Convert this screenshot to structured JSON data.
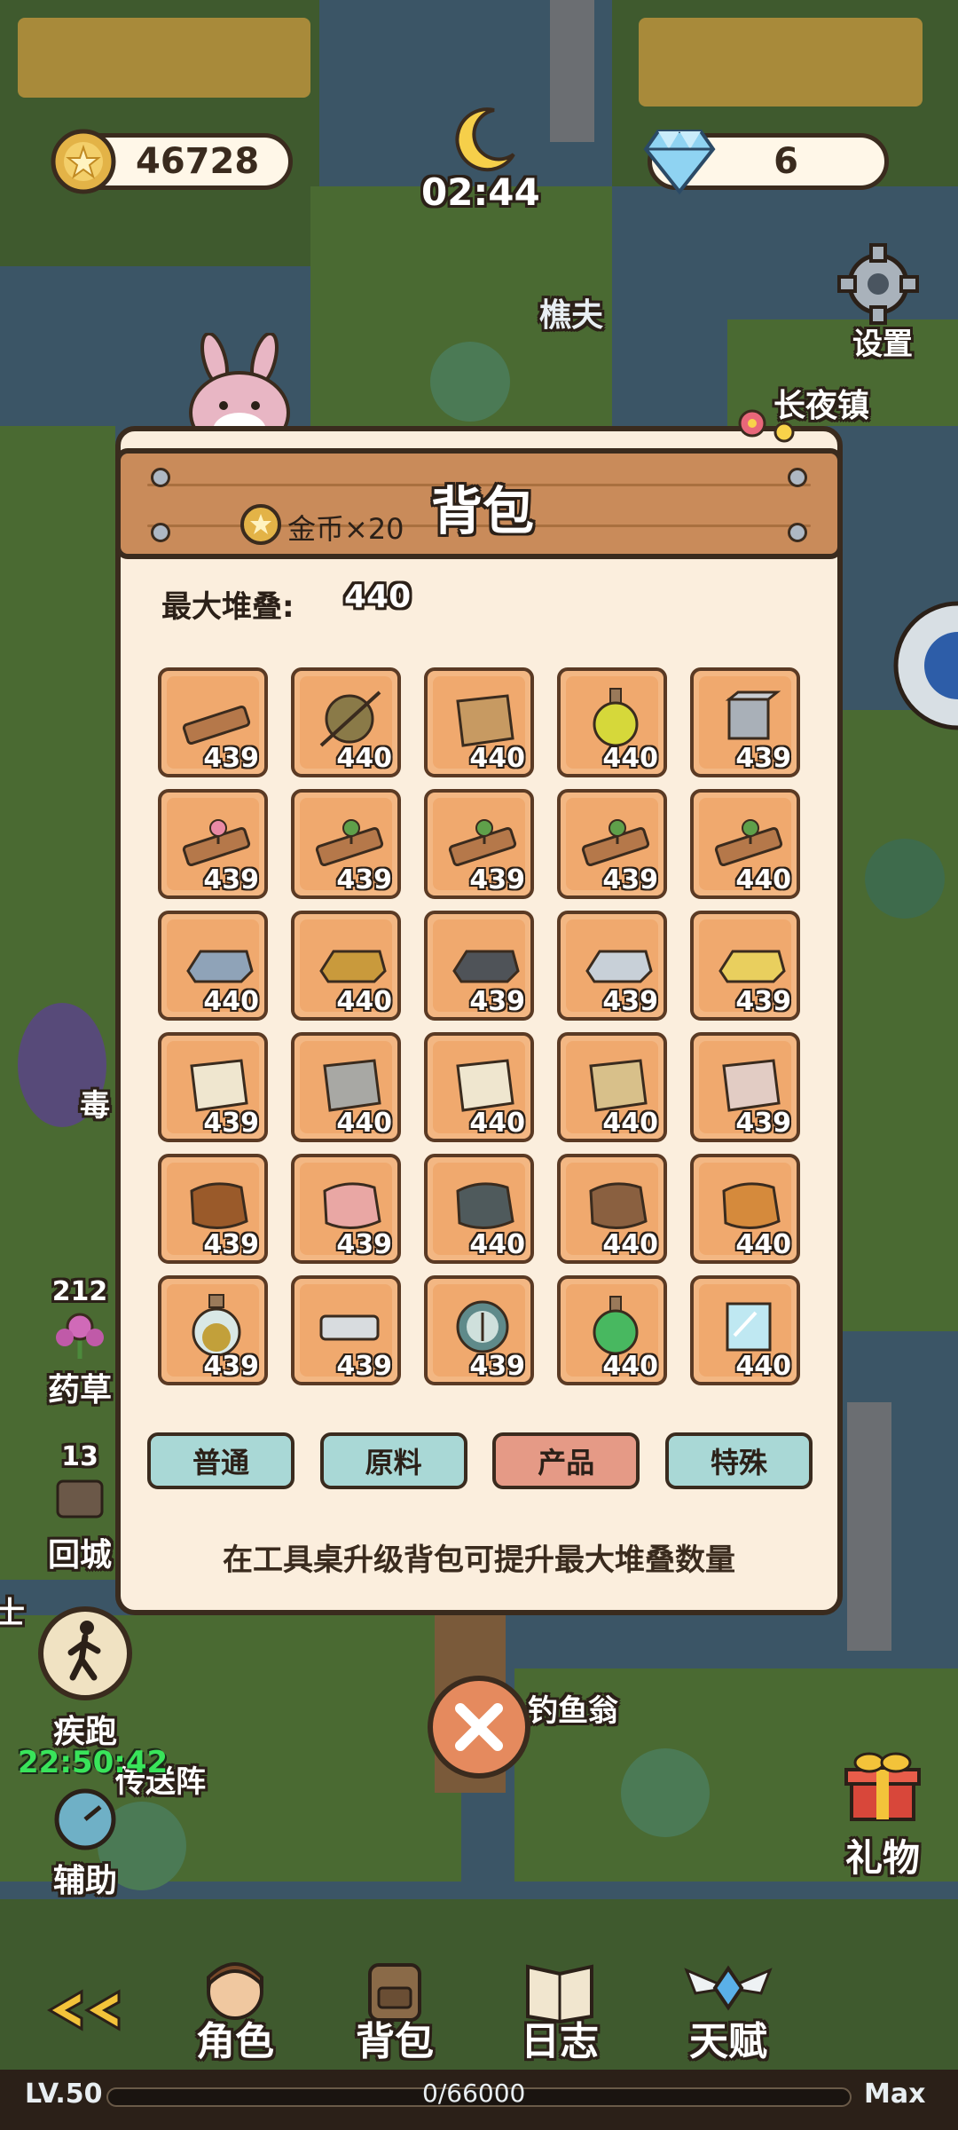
{
  "hud": {
    "coins": "46728",
    "time": "02:44",
    "gems": "6",
    "settings_label": "设置"
  },
  "map_labels": {
    "npc_woodcutter": "樵夫",
    "town": "长夜镇",
    "fisherman": "钓鱼翁",
    "poison": "毒",
    "teleport": "传送阵"
  },
  "side": {
    "herb_count": "212",
    "herb_label": "药草",
    "return_count": "13",
    "return_label": "回城",
    "run_label": "疾跑",
    "timer": "22:50:42",
    "assist_label": "辅助",
    "gift_label": "礼物",
    "left_edge_char": "士"
  },
  "inventory": {
    "title": "背包",
    "coin_reward": "金币×20",
    "max_stack_label": "最大堆叠:",
    "max_stack_value": "440",
    "items": [
      {
        "icon": "wood-plank-icon",
        "count": "439"
      },
      {
        "icon": "yarn-ball-icon",
        "count": "440"
      },
      {
        "icon": "leather-scroll-icon",
        "count": "440"
      },
      {
        "icon": "potion-bottle-icon",
        "count": "440"
      },
      {
        "icon": "metal-cube-icon",
        "count": "439"
      },
      {
        "icon": "pink-sprout-plank-icon",
        "count": "439"
      },
      {
        "icon": "green-sprout-plank-icon",
        "count": "439"
      },
      {
        "icon": "seedling-plank-icon",
        "count": "439"
      },
      {
        "icon": "sapling-plank-icon",
        "count": "439"
      },
      {
        "icon": "dark-sprout-plank-icon",
        "count": "440"
      },
      {
        "icon": "iron-ingot-icon",
        "count": "440"
      },
      {
        "icon": "bronze-ingot-icon",
        "count": "440"
      },
      {
        "icon": "dark-ingot-icon",
        "count": "439"
      },
      {
        "icon": "silver-ingot-icon",
        "count": "439"
      },
      {
        "icon": "gold-ingot-icon",
        "count": "439"
      },
      {
        "icon": "gold-trim-cloth-icon",
        "count": "439"
      },
      {
        "icon": "gray-cloth-icon",
        "count": "440"
      },
      {
        "icon": "white-cloth-icon",
        "count": "440"
      },
      {
        "icon": "tan-cloth-icon",
        "count": "440"
      },
      {
        "icon": "red-trim-cloth-icon",
        "count": "439"
      },
      {
        "icon": "glowing-hide-icon",
        "count": "439"
      },
      {
        "icon": "pink-hide-icon",
        "count": "439"
      },
      {
        "icon": "gray-hide-icon",
        "count": "440"
      },
      {
        "icon": "brown-hide-icon",
        "count": "440"
      },
      {
        "icon": "orange-leather-icon",
        "count": "440"
      },
      {
        "icon": "seed-jar-icon",
        "count": "439"
      },
      {
        "icon": "stone-brick-icon",
        "count": "439"
      },
      {
        "icon": "compass-icon",
        "count": "439"
      },
      {
        "icon": "green-flask-icon",
        "count": "440"
      },
      {
        "icon": "glass-pane-icon",
        "count": "440"
      }
    ],
    "tabs": [
      "普通",
      "原料",
      "产品",
      "特殊"
    ],
    "hint": "在工具桌升级背包可提升最大堆叠数量"
  },
  "bottom_nav": {
    "character": "角色",
    "bag": "背包",
    "journal": "日志",
    "talent": "天赋",
    "level": "LV.50",
    "xp": "0/66000",
    "max": "Max"
  },
  "colors": {
    "panel_bg": "#fbeedd",
    "banner": "#c98b5a",
    "slot": "#f3b783",
    "tab_active": "#e59a86",
    "tab_normal": "#a9d8d6"
  }
}
